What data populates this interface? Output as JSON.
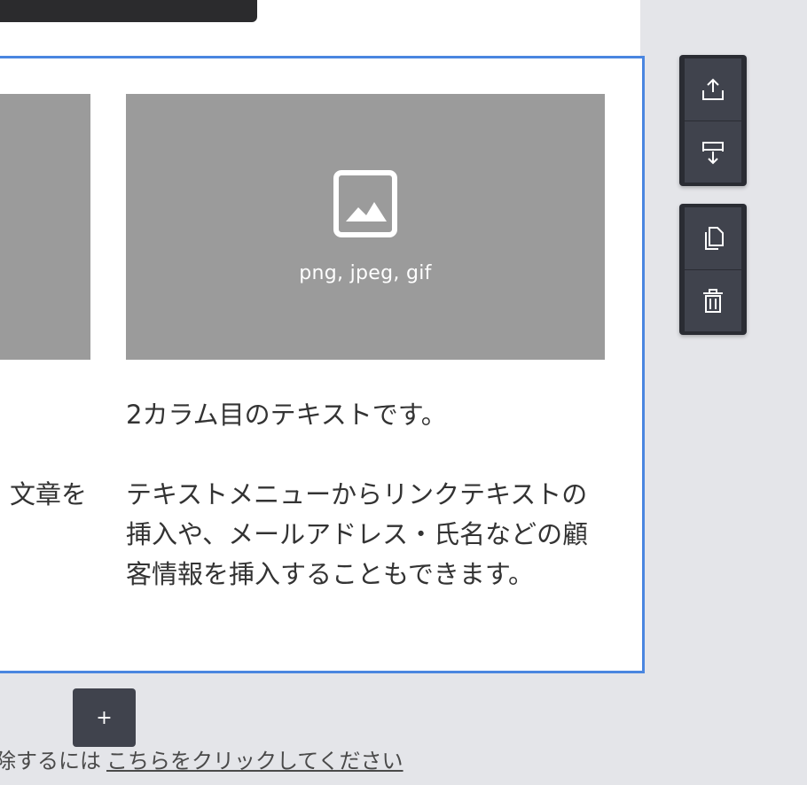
{
  "editor": {
    "image_placeholder": {
      "icon": "image-icon",
      "caption": "png, jpeg, gif"
    },
    "column2": {
      "paragraph1": "2カラム目のテキストです。",
      "paragraph2": "テキストメニューからリンクテキストの挿入や、メールアドレス・氏名などの顧客情報を挿入することもできます。"
    },
    "column1": {
      "visible_fragment": "文章を"
    }
  },
  "side_toolbar": {
    "group1": [
      "move-up-icon",
      "move-down-icon"
    ],
    "group2": [
      "copy-icon",
      "trash-icon"
    ]
  },
  "add_block": {
    "label": "+"
  },
  "footer": {
    "prefix": "除するには",
    "link": "こちらをクリックしてください"
  },
  "colors": {
    "selection_border": "#4a86e0",
    "placeholder_bg": "#9b9b9b",
    "toolbar_bg": "#40434d",
    "page_bg": "#e4e5e9"
  }
}
